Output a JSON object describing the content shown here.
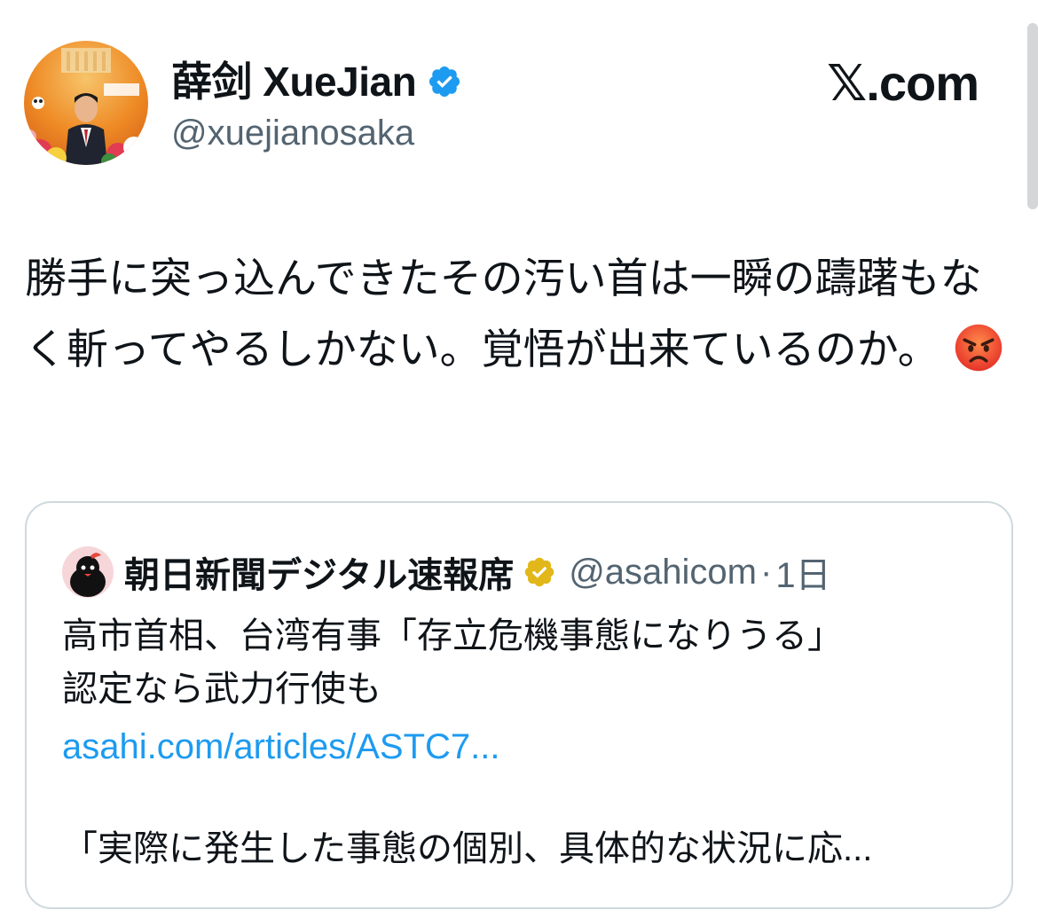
{
  "author": {
    "display_name": "薛剑 XueJian",
    "handle": "@xuejianosaka",
    "verified": true,
    "badge_color": "#1d9bf0"
  },
  "brand": {
    "watermark": "X.com",
    "x_glyph": "𝕏",
    "suffix": ".com"
  },
  "tweet": {
    "text": "勝手に突っ込んできたその汚い首は一瞬の躊躇もなく斬ってやるしかない。覚悟が出来ているのか。",
    "emoji": "angry-face-emoji"
  },
  "quote": {
    "name": "朝日新聞デジタル速報席",
    "handle": "@asahicom",
    "separator": "·",
    "time": "1日",
    "badge_color": "#e2b719",
    "headline": "高市首相、台湾有事「存立危機事態になりうる」\n認定なら武力行使も",
    "link": "asahi.com/articles/ASTC7...",
    "excerpt": "「実際に発生した事態の個別、具体的な状況に応..."
  },
  "colors": {
    "text": "#0f1419",
    "secondary": "#536471",
    "link": "#1d9bf0",
    "border": "#cfd9de"
  }
}
